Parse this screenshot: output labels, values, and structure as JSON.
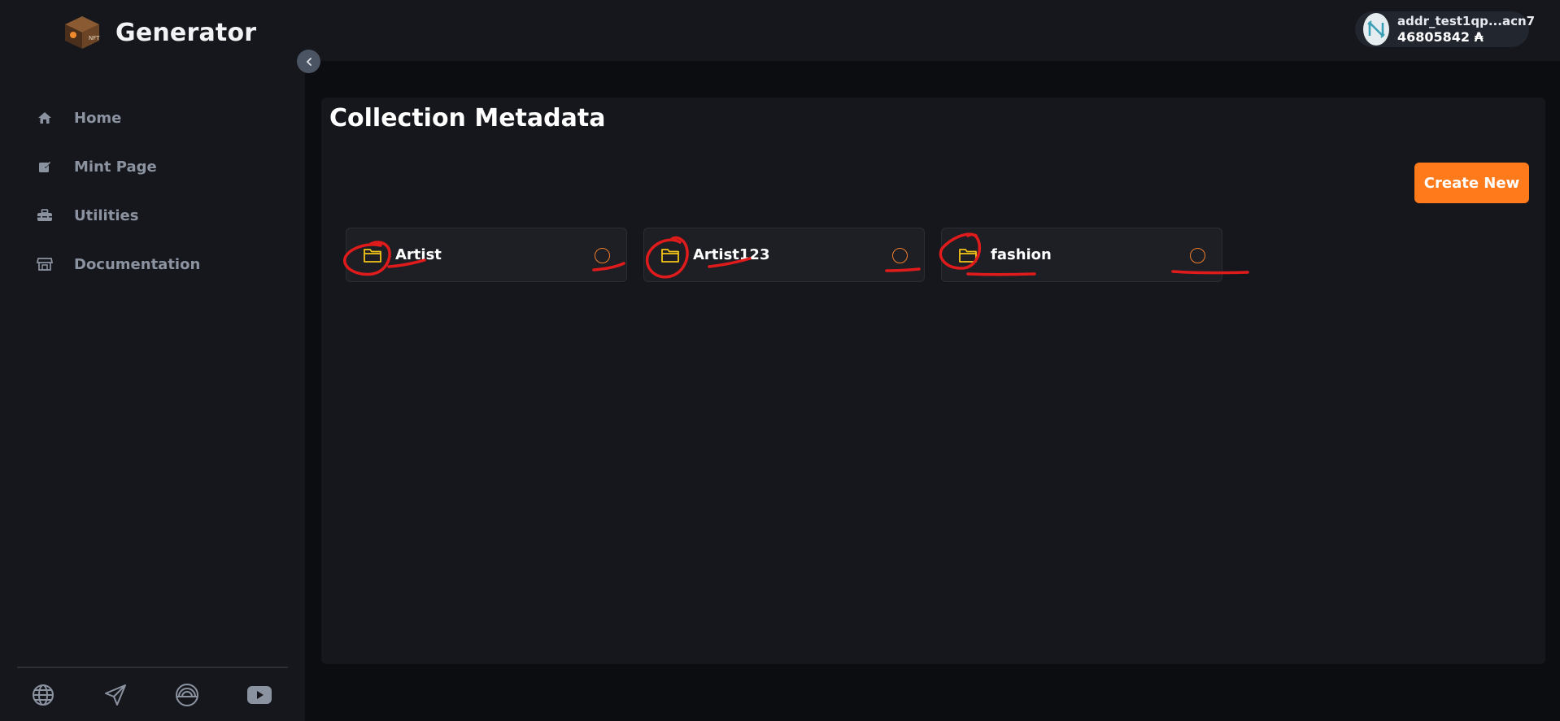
{
  "brand": {
    "title": "Generator",
    "logo_text": "NFT"
  },
  "sidebar": {
    "items": [
      {
        "label": "Home",
        "icon": "home-icon"
      },
      {
        "label": "Mint Page",
        "icon": "edit-icon"
      },
      {
        "label": "Utilities",
        "icon": "toolbox-icon"
      },
      {
        "label": "Documentation",
        "icon": "store-icon"
      }
    ],
    "social": [
      "globe-icon",
      "send-icon",
      "rainbow-icon",
      "youtube-icon"
    ]
  },
  "wallet": {
    "address": "addr_test1qp...acn7",
    "balance": "46805842 ₳"
  },
  "main": {
    "title": "Collection Metadata",
    "create_label": "Create New",
    "folders": [
      {
        "label": "Artist"
      },
      {
        "label": "Artist123"
      },
      {
        "label": "fashion"
      }
    ]
  },
  "colors": {
    "accent": "#ff7a1a",
    "folder": "#f5c518",
    "annotation": "#e01b1b"
  }
}
